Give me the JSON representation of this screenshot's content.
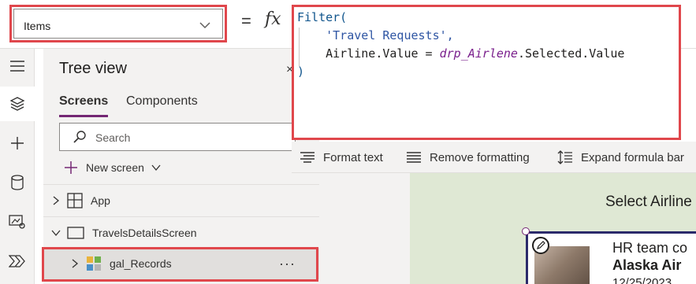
{
  "property_selector": {
    "value": "Items"
  },
  "formula_bar": {
    "equals": "=",
    "fx": "fx",
    "lines": [
      "Filter(",
      "'Travel Requests',",
      "Airline.Value = ",
      "drp_Airlene",
      ".Selected.Value",
      ")"
    ]
  },
  "format_toolbar": {
    "format_text": "Format text",
    "remove_formatting": "Remove formatting",
    "expand_formula_bar": "Expand formula bar"
  },
  "tree_view": {
    "title": "Tree view",
    "close": "×",
    "tabs": [
      "Screens",
      "Components"
    ],
    "search_placeholder": "Search",
    "new_screen": "New screen",
    "items": [
      {
        "label": "App"
      },
      {
        "label": "TravelsDetailsScreen"
      },
      {
        "label": "gal_Records",
        "more": "···"
      }
    ]
  },
  "canvas": {
    "title": "Select Airline",
    "gallery": {
      "line1": "HR team co",
      "line2": "Alaska Air",
      "line3": "12/25/2023"
    }
  },
  "colors": {
    "highlight": "#e0474c",
    "accent": "#742774",
    "canvas_bg": "#dfe8d4"
  }
}
